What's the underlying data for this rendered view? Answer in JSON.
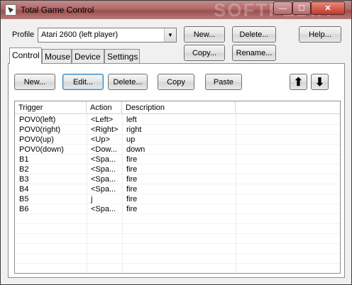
{
  "window": {
    "title": "Total Game Control",
    "watermark": "SOFTPEDIA"
  },
  "caption": {
    "minimize": "—",
    "maximize": "☐",
    "close": "✕"
  },
  "profile": {
    "label": "Profile",
    "selected": "Atari 2600 (left player)",
    "buttons": {
      "new": "New...",
      "delete": "Delete...",
      "copy": "Copy...",
      "rename": "Rename...",
      "help": "Help..."
    }
  },
  "tabs": [
    {
      "label": "Control",
      "active": true
    },
    {
      "label": "Mouse",
      "active": false
    },
    {
      "label": "Device",
      "active": false
    },
    {
      "label": "Settings",
      "active": false
    }
  ],
  "toolbar": {
    "new": "New...",
    "edit": "Edit...",
    "delete": "Delete...",
    "copy": "Copy",
    "paste": "Paste",
    "up": "⬆",
    "down": "⬇"
  },
  "list": {
    "columns": [
      "Trigger",
      "Action",
      "Description"
    ],
    "rows": [
      {
        "trigger": "POV0(left)",
        "action": "<Left>",
        "description": "left"
      },
      {
        "trigger": "POV0(right)",
        "action": "<Right>",
        "description": "right"
      },
      {
        "trigger": "POV0(up)",
        "action": "<Up>",
        "description": "up"
      },
      {
        "trigger": "POV0(down)",
        "action": "<Dow...",
        "description": "down"
      },
      {
        "trigger": "B1",
        "action": "<Spa...",
        "description": "fire"
      },
      {
        "trigger": "B2",
        "action": "<Spa...",
        "description": "fire"
      },
      {
        "trigger": "B3",
        "action": "<Spa...",
        "description": "fire"
      },
      {
        "trigger": "B4",
        "action": "<Spa...",
        "description": "fire"
      },
      {
        "trigger": "B5",
        "action": "j",
        "description": "fire"
      },
      {
        "trigger": "B6",
        "action": "<Spa...",
        "description": "fire"
      }
    ]
  }
}
